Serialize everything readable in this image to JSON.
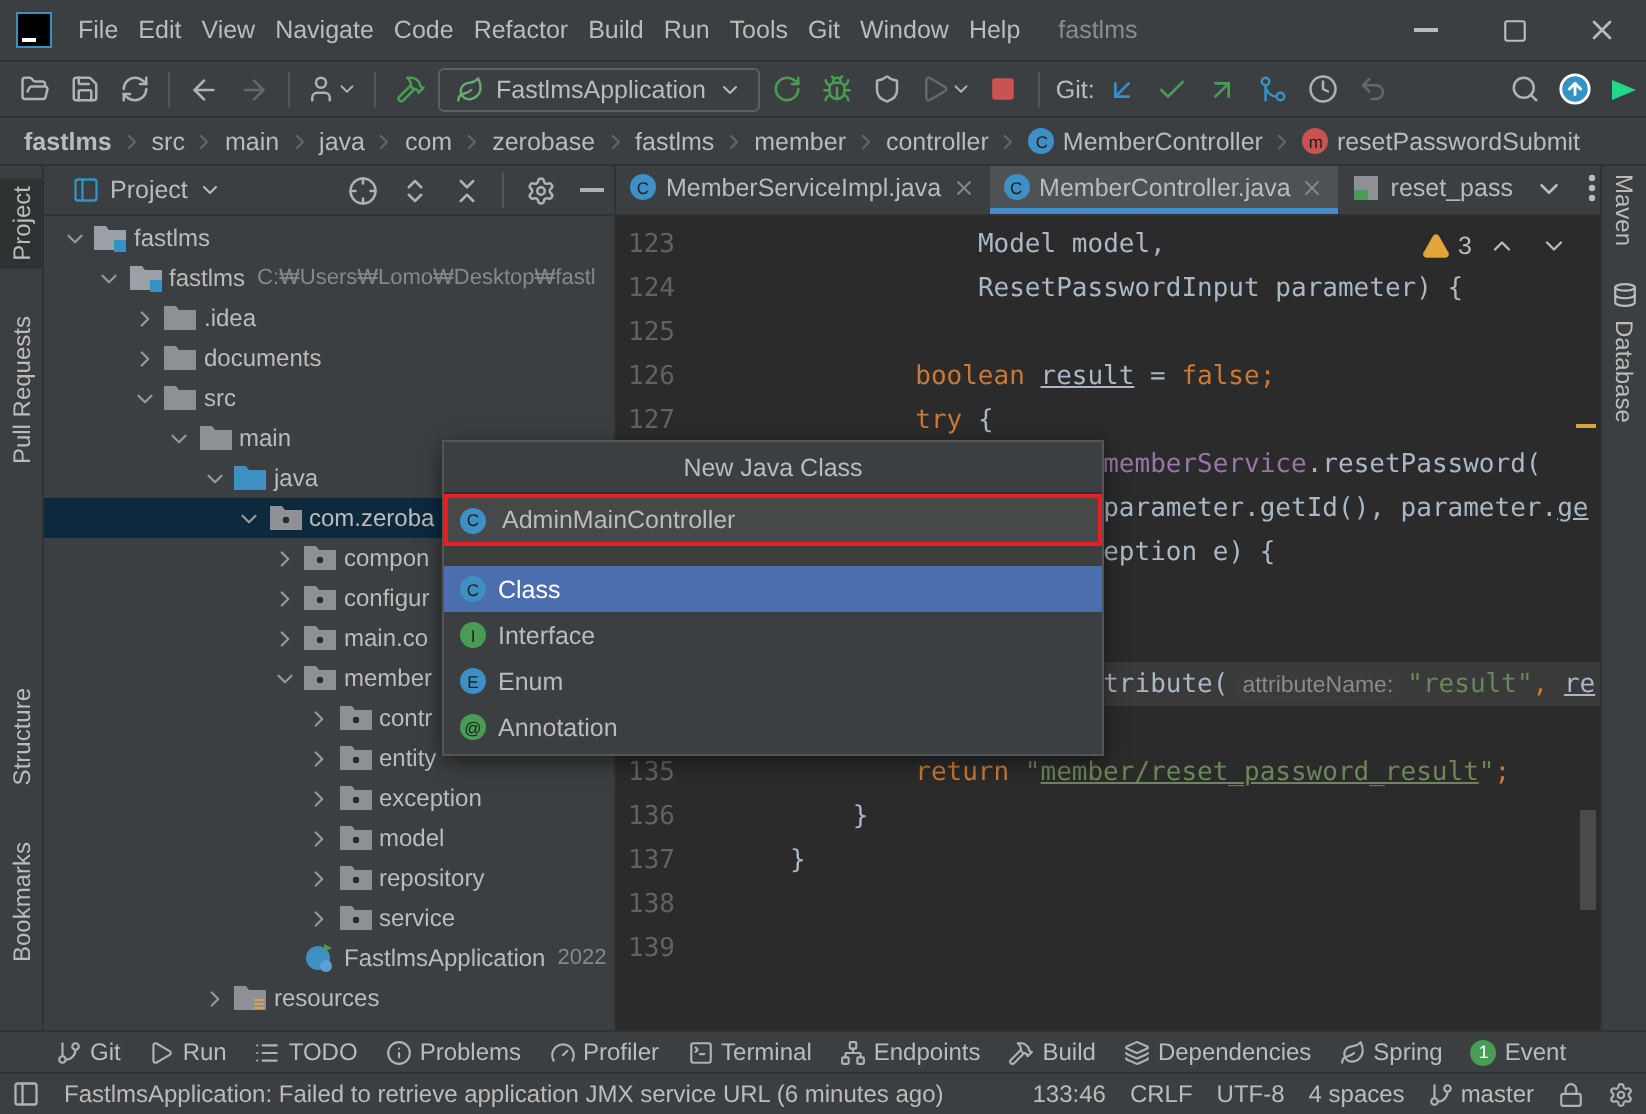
{
  "menu_bar": {
    "items": [
      "File",
      "Edit",
      "View",
      "Navigate",
      "Code",
      "Refactor",
      "Build",
      "Run",
      "Tools",
      "Git",
      "Window",
      "Help"
    ],
    "title": "fastlms"
  },
  "toolbar": {
    "run_configuration": "FastlmsApplication",
    "git_label": "Git:"
  },
  "breadcrumbs": [
    {
      "text": "fastlms",
      "kind": "project"
    },
    {
      "text": "src",
      "kind": "folder"
    },
    {
      "text": "main",
      "kind": "folder"
    },
    {
      "text": "java",
      "kind": "folder"
    },
    {
      "text": "com",
      "kind": "folder"
    },
    {
      "text": "zerobase",
      "kind": "folder"
    },
    {
      "text": "fastlms",
      "kind": "folder"
    },
    {
      "text": "member",
      "kind": "folder"
    },
    {
      "text": "controller",
      "kind": "folder"
    },
    {
      "text": "MemberController",
      "kind": "class",
      "icon_letter": "C"
    },
    {
      "text": "resetPasswordSubmit",
      "kind": "method",
      "icon_letter": "m"
    }
  ],
  "left_stripe": {
    "top": [
      {
        "label": "Project",
        "selected": true
      },
      {
        "label": "Pull Requests",
        "selected": false
      }
    ],
    "bottom": [
      {
        "label": "Structure",
        "selected": false
      },
      {
        "label": "Bookmarks",
        "selected": false
      }
    ]
  },
  "project_panel": {
    "title": "Project",
    "tree": [
      {
        "label": "fastlms",
        "kind": "module",
        "expanded": true,
        "selected": false,
        "children": [
          {
            "label": "fastlms",
            "note": "C:₩Users₩Lomo₩Desktop₩fastl",
            "kind": "module",
            "expanded": true,
            "selected": false,
            "children": [
              {
                "label": ".idea",
                "kind": "folder",
                "expanded": false,
                "selected": false
              },
              {
                "label": "documents",
                "kind": "folder",
                "expanded": false,
                "selected": false
              },
              {
                "label": "src",
                "kind": "folder",
                "expanded": true,
                "selected": false,
                "children": [
                  {
                    "label": "main",
                    "kind": "folder",
                    "expanded": true,
                    "selected": false,
                    "children": [
                      {
                        "label": "java",
                        "kind": "source",
                        "expanded": true,
                        "selected": false,
                        "children": [
                          {
                            "label": "com.zeroba",
                            "kind": "package",
                            "expanded": true,
                            "selected": true,
                            "children": [
                              {
                                "label": "compon",
                                "kind": "package",
                                "expanded": false,
                                "selected": false
                              },
                              {
                                "label": "configur",
                                "kind": "package",
                                "expanded": false,
                                "selected": false
                              },
                              {
                                "label": "main.co",
                                "kind": "package",
                                "expanded": false,
                                "selected": false
                              },
                              {
                                "label": "member",
                                "kind": "package",
                                "expanded": true,
                                "selected": false,
                                "children": [
                                  {
                                    "label": "contr",
                                    "kind": "package",
                                    "expanded": false,
                                    "selected": false
                                  },
                                  {
                                    "label": "entity",
                                    "kind": "package",
                                    "expanded": false,
                                    "selected": false
                                  },
                                  {
                                    "label": "exception",
                                    "kind": "package",
                                    "expanded": false,
                                    "selected": false
                                  },
                                  {
                                    "label": "model",
                                    "kind": "package",
                                    "expanded": false,
                                    "selected": false
                                  },
                                  {
                                    "label": "repository",
                                    "kind": "package",
                                    "expanded": false,
                                    "selected": false
                                  },
                                  {
                                    "label": "service",
                                    "kind": "package",
                                    "expanded": false,
                                    "selected": false
                                  }
                                ]
                              },
                              {
                                "label": "FastlmsApplication",
                                "note": "2022",
                                "kind": "app",
                                "selected": false
                              }
                            ]
                          }
                        ]
                      },
                      {
                        "label": "resources",
                        "kind": "resources",
                        "expanded": false,
                        "selected": false
                      }
                    ]
                  }
                ]
              }
            ]
          }
        ]
      }
    ]
  },
  "editor": {
    "tabs": [
      {
        "label": "MemberServiceImpl.java",
        "kind": "class",
        "icon_letter": "C",
        "selected": false
      },
      {
        "label": "MemberController.java",
        "kind": "class",
        "icon_letter": "C",
        "selected": true
      },
      {
        "label": "reset_pass",
        "kind": "html",
        "selected": false
      }
    ],
    "warnings": "3",
    "lines": [
      {
        "number": "123",
        "kind": "parameter",
        "segments": [
          {
            "text": "Model model,",
            "kind": "plain"
          }
        ]
      },
      {
        "number": "124",
        "kind": "parameter",
        "segments": [
          {
            "text": "ResetPasswordInput parameter) {",
            "kind": "plain"
          }
        ]
      },
      {
        "number": "125",
        "kind": "blank"
      },
      {
        "number": "126",
        "kind": "body",
        "segments": [
          {
            "text": "boolean ",
            "kind": "keyword"
          },
          {
            "text": "result",
            "kind": "var"
          },
          {
            "text": " = ",
            "kind": "plain"
          },
          {
            "text": "false;",
            "kind": "keyword"
          }
        ]
      },
      {
        "number": "127",
        "kind": "body",
        "segments": [
          {
            "text": "try ",
            "kind": "keyword"
          },
          {
            "text": "{",
            "kind": "plain"
          }
        ]
      },
      {
        "kind": "continuation",
        "segments": [
          {
            "text": "memberService",
            "kind": "field"
          },
          {
            "text": ".resetPassword(",
            "kind": "plain"
          }
        ]
      },
      {
        "kind": "continuation",
        "segments": [
          {
            "text": "parameter.getId(), parameter.",
            "kind": "plain"
          },
          {
            "text": "ge",
            "kind": "var"
          }
        ]
      },
      {
        "kind": "continuation",
        "segments": [
          {
            "text": "eption e) {",
            "kind": "plain"
          }
        ]
      },
      {
        "kind": "blank"
      },
      {
        "kind": "blank"
      },
      {
        "kind": "continuation",
        "current": true,
        "segments": [
          {
            "text": "tribute(",
            "kind": "plain"
          },
          {
            "text": "attributeName:",
            "kind": "hint"
          },
          {
            "text": "\"result\"",
            "kind": "string"
          },
          {
            "text": ", ",
            "kind": "keyword"
          },
          {
            "text": "re",
            "kind": "var"
          }
        ]
      },
      {
        "kind": "blank"
      },
      {
        "number": "135",
        "kind": "body",
        "segments": [
          {
            "text": "return ",
            "kind": "keyword"
          },
          {
            "text": "\"",
            "kind": "string"
          },
          {
            "text": "member/reset_password_result",
            "kind": "link"
          },
          {
            "text": "\"",
            "kind": "string"
          },
          {
            "text": ";",
            "kind": "keyword"
          }
        ]
      },
      {
        "number": "136",
        "kind": "method_end",
        "segments": [
          {
            "text": "}",
            "kind": "plain"
          }
        ]
      },
      {
        "number": "137",
        "kind": "class_end",
        "segments": [
          {
            "text": "}",
            "kind": "plain"
          }
        ]
      },
      {
        "number": "138",
        "kind": "blank"
      },
      {
        "number": "139",
        "kind": "blank"
      }
    ]
  },
  "right_stripe": [
    {
      "label": "Maven",
      "kind": "maven"
    },
    {
      "label": "Database",
      "kind": "database"
    }
  ],
  "popup": {
    "title": "New Java Class",
    "name_value": "AdminMainController",
    "name_icon_letter": "C",
    "options": [
      {
        "label": "Class",
        "icon_letter": "C",
        "kind": "blue",
        "selected": true
      },
      {
        "label": "Interface",
        "icon_letter": "I",
        "kind": "green",
        "selected": false
      },
      {
        "label": "Enum",
        "icon_letter": "E",
        "kind": "blue",
        "selected": false
      },
      {
        "label": "Annotation",
        "icon_letter": "@",
        "kind": "green",
        "selected": false
      }
    ]
  },
  "tool_windows": [
    {
      "label": "Git",
      "kind": "git"
    },
    {
      "label": "Run",
      "kind": "run"
    },
    {
      "label": "TODO",
      "kind": "todo"
    },
    {
      "label": "Problems",
      "kind": "problems"
    },
    {
      "label": "Profiler",
      "kind": "profiler"
    },
    {
      "label": "Terminal",
      "kind": "terminal"
    },
    {
      "label": "Endpoints",
      "kind": "endpoints"
    },
    {
      "label": "Build",
      "kind": "build"
    },
    {
      "label": "Dependencies",
      "kind": "dependencies"
    },
    {
      "label": "Spring",
      "kind": "spring"
    },
    {
      "label": "Event",
      "kind": "event",
      "badge": "1"
    }
  ],
  "status_bar": {
    "message": "FastlmsApplication: Failed to retrieve application JMX service URL (6 minutes ago)",
    "position": "133:46",
    "line_separator": "CRLF",
    "encoding": "UTF-8",
    "indent": "4 spaces",
    "branch": "master"
  }
}
